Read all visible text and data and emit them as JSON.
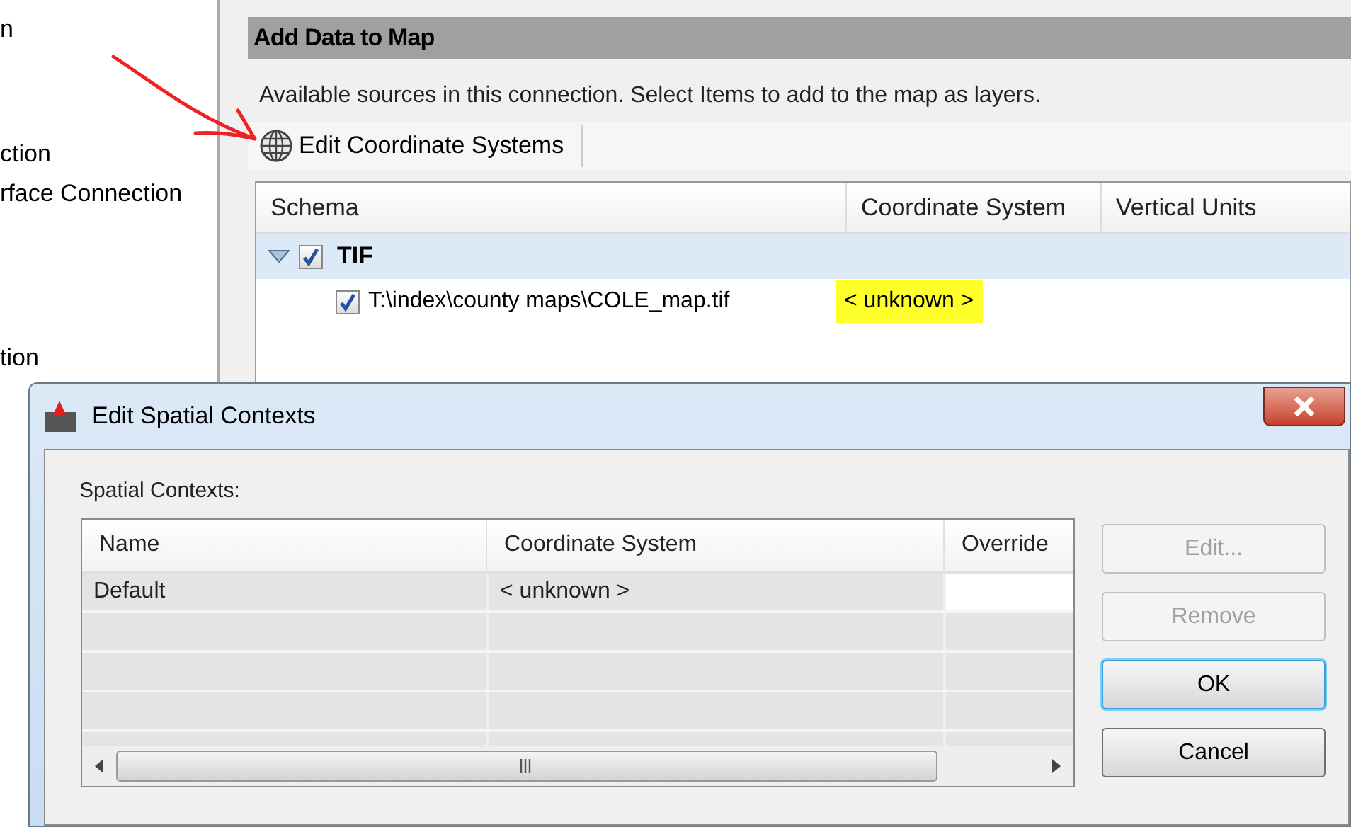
{
  "left_panel": {
    "items": [
      "n",
      "ction",
      "rface Connection",
      "tion"
    ]
  },
  "main_panel": {
    "title": "Add Data to Map",
    "description": "Available sources in this connection.  Select Items to add to the map as layers.",
    "toolbar": [
      {
        "label": "Edit Coordinate Systems"
      }
    ],
    "tree": {
      "columns": [
        "Schema",
        "Coordinate System",
        "Vertical Units"
      ],
      "rows": [
        {
          "label": "TIF",
          "checked": true,
          "expanded": true,
          "selected": true,
          "children": [
            {
              "label": "T:\\index\\county maps\\COLE_map.tif",
              "checked": true,
              "selected": false,
              "coordinate_system": "< unknown >",
              "highlighted": true
            }
          ]
        }
      ]
    }
  },
  "dialog": {
    "title": "Edit Spatial Contexts",
    "label": "Spatial Contexts:",
    "grid": {
      "columns": [
        "Name",
        "Coordinate System",
        "Override"
      ],
      "rows": [
        {
          "name": "Default",
          "coordinate_system": "< unknown >"
        }
      ]
    },
    "buttons": [
      {
        "label": "Edit...",
        "disabled": true,
        "default": false
      },
      {
        "label": "Remove",
        "disabled": true,
        "default": false
      },
      {
        "label": "OK",
        "disabled": false,
        "default": true
      },
      {
        "label": "Cancel",
        "disabled": false,
        "default": false
      }
    ]
  }
}
